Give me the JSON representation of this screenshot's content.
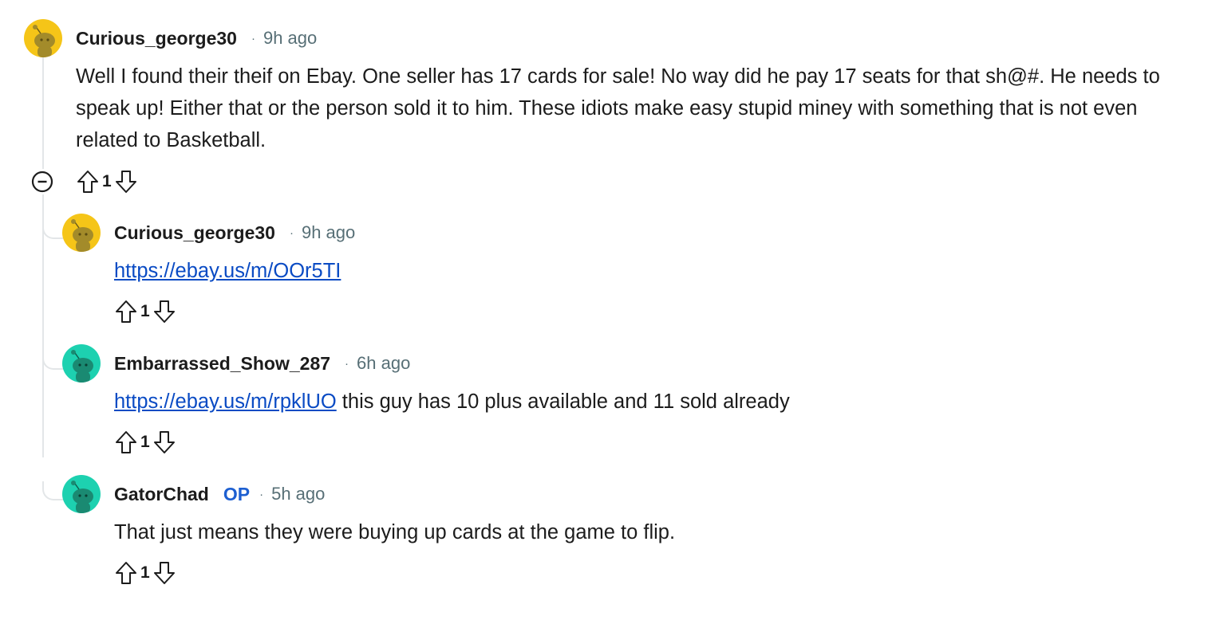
{
  "comments": [
    {
      "author": "Curious_george30",
      "op_badge": "",
      "separator": "·",
      "time": "9h ago",
      "body_link": "",
      "body": "Well I found their theif on Ebay. One seller has 17 cards for sale! No way did he pay 17 seats for that sh@#. He needs to speak up! Either that or the person sold it to him. These idiots make easy stupid miney with something that is not even related to Basketball.",
      "score": "1",
      "avatar_color": "#f5c518"
    },
    {
      "author": "Curious_george30",
      "op_badge": "",
      "separator": "·",
      "time": "9h ago",
      "body_link": "https://ebay.us/m/OOr5TI",
      "body": "",
      "score": "1",
      "avatar_color": "#f5c518"
    },
    {
      "author": "Embarrassed_Show_287",
      "op_badge": "",
      "separator": "·",
      "time": "6h ago",
      "body_link": "https://ebay.us/m/rpklUO",
      "body": " this guy has 10 plus available and 11 sold already",
      "score": "1",
      "avatar_color": "#1dd1b0"
    },
    {
      "author": "GatorChad",
      "op_badge": "OP",
      "separator": "·",
      "time": "5h ago",
      "body_link": "",
      "body": "That just means they were buying up cards at the game to flip.",
      "score": "1",
      "avatar_color": "#1dd1b0"
    }
  ],
  "icons": {
    "upvote": "upvote-arrow-icon",
    "downvote": "downvote-arrow-icon",
    "collapse": "collapse-minus-icon",
    "avatar": "snoo-avatar-icon"
  },
  "colors": {
    "link": "#0a4bc4",
    "op_badge": "#1d5fd1",
    "meta_text": "#576f76",
    "thread_line": "#e3e6e8"
  }
}
